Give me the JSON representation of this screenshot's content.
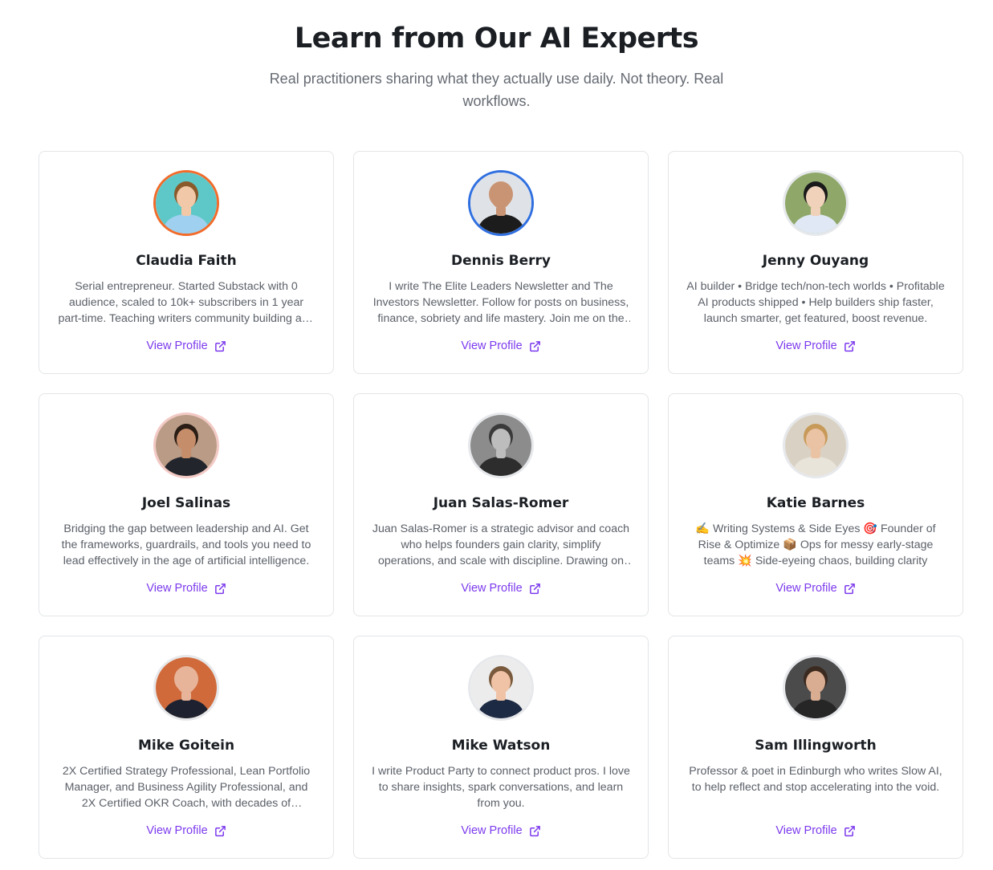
{
  "header": {
    "title": "Learn from Our AI Experts",
    "subtitle": "Real practitioners sharing what they actually use daily. Not theory. Real workflows."
  },
  "link_icon": "external-link-icon",
  "experts": [
    {
      "name": "Claudia Faith",
      "bio": "Serial entrepreneur. Started Substack with 0 audience, scaled to 10k+ subscribers in 1 year part-time. Teaching writers community building and monetization.",
      "link_label": "View Profile",
      "ring": "#f26b2a",
      "bg": "#5ec8c8",
      "skin": "#f2c9a8",
      "hair": "#8a5a2b",
      "shirt": "#9fd0f0"
    },
    {
      "name": "Dennis Berry",
      "bio": "I write The Elite Leaders Newsletter and The Investors Newsletter. Follow for posts on business, finance, sobriety and life mastery. Join me on the journey.",
      "link_label": "View Profile",
      "ring": "#2f6fe0",
      "bg": "#dfe3e8",
      "skin": "#c99473",
      "hair": "#c99473",
      "shirt": "#1c1c1c"
    },
    {
      "name": "Jenny Ouyang",
      "bio": "AI builder • Bridge tech/non-tech worlds • Profitable AI products shipped • Help builders ship faster, launch smarter, get featured, boost revenue.",
      "link_label": "View Profile",
      "ring": "#e6e8eb",
      "bg": "#8fa86a",
      "skin": "#f0d2bb",
      "hair": "#1a1a1a",
      "shirt": "#dfe8f4"
    },
    {
      "name": "Joel Salinas",
      "bio": "Bridging the gap between leadership and AI. Get the frameworks, guardrails, and tools you need to lead effectively in the age of artificial intelligence.",
      "link_label": "View Profile",
      "ring": "#f3c9c4",
      "bg": "#b99b86",
      "skin": "#c68d6a",
      "hair": "#2a1d15",
      "shirt": "#22252b"
    },
    {
      "name": "Juan Salas-Romer",
      "bio": "Juan Salas-Romer is a strategic advisor and coach who helps founders gain clarity, simplify operations, and scale with discipline. Drawing on decades of experience.",
      "link_label": "View Profile",
      "ring": "#e6e8eb",
      "bg": "#8c8c8c",
      "skin": "#bdbdbd",
      "hair": "#3a3a3a",
      "shirt": "#2d2d2d"
    },
    {
      "name": "Katie Barnes",
      "bio": "✍️ Writing Systems & Side Eyes 🎯 Founder of Rise & Optimize 📦 Ops for messy early-stage teams 💥 Side-eyeing chaos, building clarity",
      "link_label": "View Profile",
      "ring": "#e6e8eb",
      "bg": "#d9d2c4",
      "skin": "#eac3a4",
      "hair": "#c79a5a",
      "shirt": "#e9e4da"
    },
    {
      "name": "Mike Goitein",
      "bio": "2X Certified Strategy Professional, Lean Portfolio Manager, and Business Agility Professional, and 2X Certified OKR Coach, with decades of experience.",
      "link_label": "View Profile",
      "ring": "#e6e8eb",
      "bg": "#d06a3a",
      "skin": "#e7b49a",
      "hair": "#e7b49a",
      "shirt": "#1e2230"
    },
    {
      "name": "Mike Watson",
      "bio": "I write Product Party to connect product pros. I love to share insights, spark conversations, and learn from you.",
      "link_label": "View Profile",
      "ring": "#e6e8eb",
      "bg": "#ececec",
      "skin": "#f0c3a6",
      "hair": "#7a5a3c",
      "shirt": "#1d2a44"
    },
    {
      "name": "Sam Illingworth",
      "bio": "Professor & poet in Edinburgh who writes Slow AI, to help reflect and stop accelerating into the void.",
      "link_label": "View Profile",
      "ring": "#e6e8eb",
      "bg": "#4b4b4b",
      "skin": "#d9ad92",
      "hair": "#3b2a20",
      "shirt": "#262626"
    }
  ]
}
